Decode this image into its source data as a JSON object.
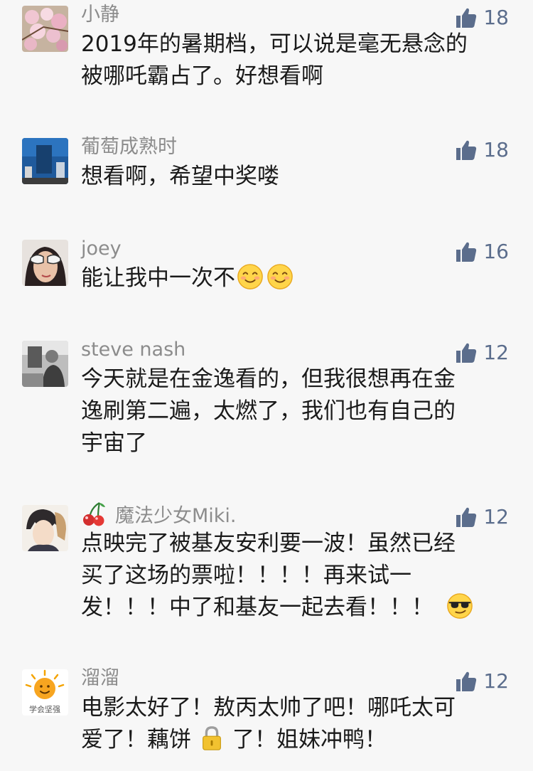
{
  "comments": [
    {
      "name": "小静",
      "likes": "18",
      "text": "2019年的暑期档，可以说是毫无悬念的\n被哪吒霸占了。好想看啊"
    },
    {
      "name": "葡萄成熟时",
      "likes": "18",
      "text": "想看啊，希望中奖喽"
    },
    {
      "name": "joey",
      "likes": "16",
      "text": "能让我中一次不"
    },
    {
      "name": "steve nash",
      "likes": "12",
      "text": "今天就是在金逸看的，但我很想再在金\n逸刷第二遍，太燃了，我们也有自己的\n宇宙了"
    },
    {
      "name": "魔法少女Miki.",
      "likes": "12",
      "text_line1": "点映完了被基友安利要一波！虽然已经",
      "text_line2": "买了这场的票啦！！！！再来试一",
      "text_line3": "发！！！中了和基友一起去看！！！"
    },
    {
      "name": "溜溜",
      "likes": "12",
      "text_line1": "电影太好了！敖丙太帅了吧！哪吒太可",
      "text_line2a": "爱了！藕饼",
      "text_line2b": "了！姐妹冲鸭！",
      "avatar_caption": "学会坚强"
    }
  ],
  "icons": {
    "like": "thumbs-up-icon",
    "smile": "smiling-face-emoji",
    "sunglasses": "sunglasses-face-emoji",
    "cherry": "cherry-emoji",
    "lock": "lock-emoji"
  },
  "colors": {
    "background": "#f7f7f7",
    "name": "#8c8c8c",
    "like": "#5b6d8c",
    "text": "#1a1a1a"
  }
}
